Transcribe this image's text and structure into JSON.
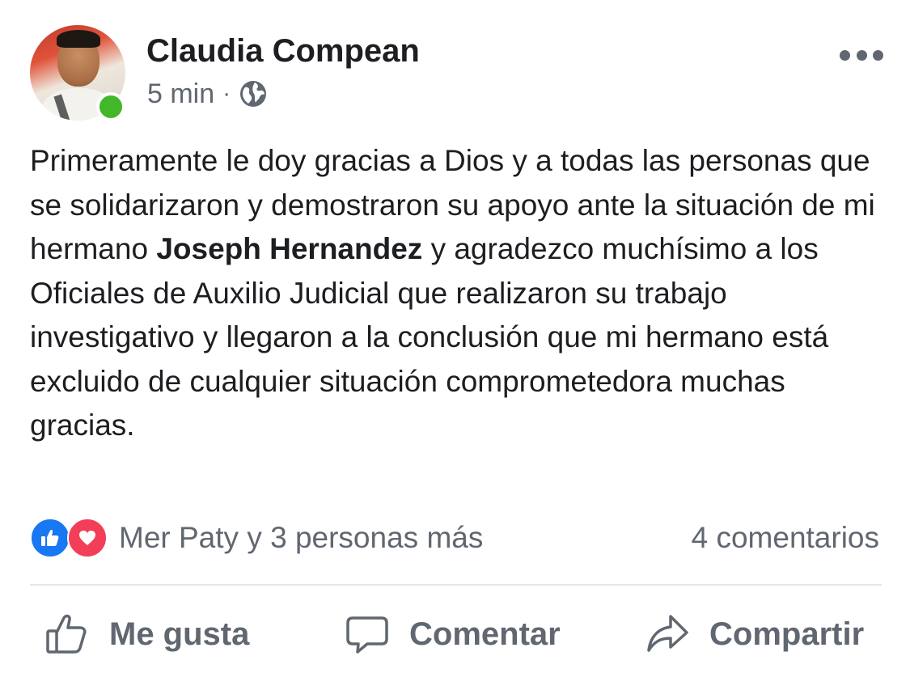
{
  "post": {
    "author": "Claudia Compean",
    "time": "5 min",
    "separator": "·",
    "privacy_icon": "globe-icon",
    "text_part1": "Primeramente le doy gracias a Dios y a todas las personas que se solidarizaron y demostraron su apoyo ante la situación de mi hermano ",
    "mention": "Joseph Hernandez",
    "text_part2": " y agradezco muchísimo a los Oficiales de Auxilio Judicial que realizaron su trabajo investigativo y llegaron a la conclusión que mi hermano está excluido de cualquier situación comprometedora muchas gracias."
  },
  "reactions": {
    "icons": [
      "like-icon",
      "love-icon"
    ],
    "summary": "Mer Paty y 3 personas más",
    "comments_count": "4 comentarios"
  },
  "actions": {
    "like": "Me gusta",
    "comment": "Comentar",
    "share": "Compartir"
  },
  "colors": {
    "like_blue": "#1877f2",
    "love_red": "#f33e58",
    "online_green": "#42b72a",
    "secondary_text": "#606770"
  }
}
